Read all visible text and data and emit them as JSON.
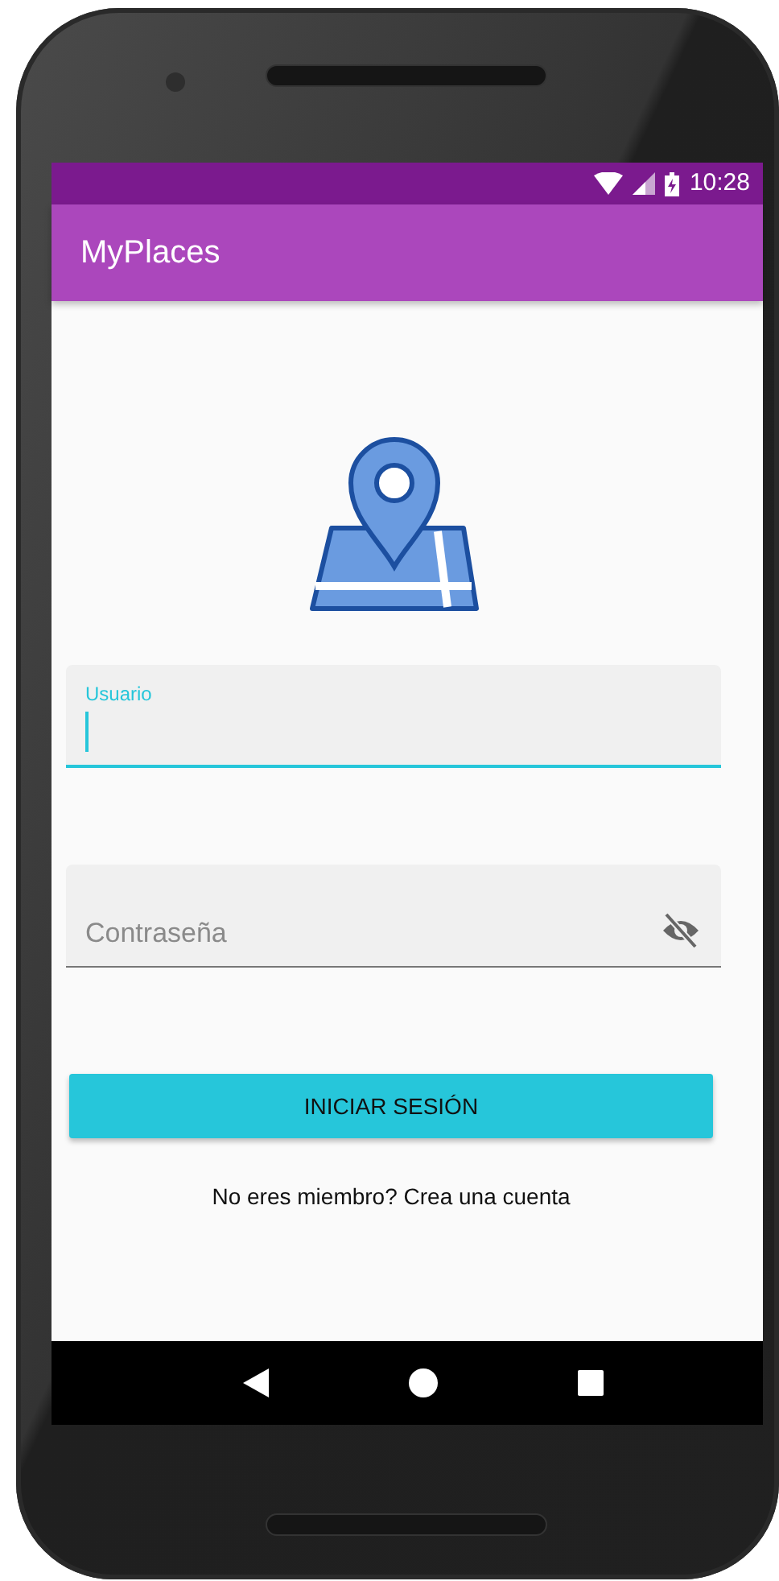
{
  "status_bar": {
    "time": "10:28"
  },
  "app_bar": {
    "title": "MyPlaces"
  },
  "fields": [
    {
      "kind": "text",
      "label": "Usuario",
      "focused": true
    },
    {
      "kind": "password",
      "placeholder": "Contraseña",
      "focused": false
    }
  ],
  "login_button": "INICIAR SESIÓN",
  "signup_text": "No eres miembro? Crea una cuenta"
}
